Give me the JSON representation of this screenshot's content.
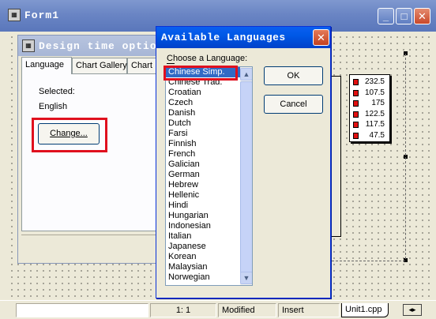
{
  "form1": {
    "title": "Form1",
    "icon": "cbuilder-form-icon",
    "buttons": {
      "minimize": "_",
      "maximize": "□",
      "close": "✕"
    }
  },
  "design_options": {
    "title": "Design time options",
    "tabs": [
      "Language",
      "Chart Gallery",
      "Chart"
    ],
    "selected_label": "Selected:",
    "selected_value": "English",
    "change_button": "Change..."
  },
  "chart_legend": {
    "values": [
      "232.5",
      "107.5",
      "175",
      "122.5",
      "117.5",
      "47.5"
    ],
    "swatch_color": "#e01010"
  },
  "dialog": {
    "title": "Available Languages",
    "close": "✕",
    "prompt": "Choose a Language:",
    "ok_button": "OK",
    "cancel_button": "Cancel",
    "languages": [
      "Chinese Simp.",
      "Chinese Trad.",
      "Croatian",
      "Czech",
      "Danish",
      "Dutch",
      "Farsi",
      "Finnish",
      "French",
      "Galician",
      "German",
      "Hebrew",
      "Hellenic",
      "Hindi",
      "Hungarian",
      "Indonesian",
      "Italian",
      "Japanese",
      "Korean",
      "Malaysian",
      "Norwegian"
    ],
    "selected_language": "Chinese Simp."
  },
  "status_bar": {
    "position": "1:   1",
    "modified": "Modified",
    "mode": "Insert",
    "file_tab": "Unit1.cpp"
  },
  "colors": {
    "highlight": "#e0101e",
    "selection": "#316ac5",
    "xp_blue": "#0058e6"
  }
}
